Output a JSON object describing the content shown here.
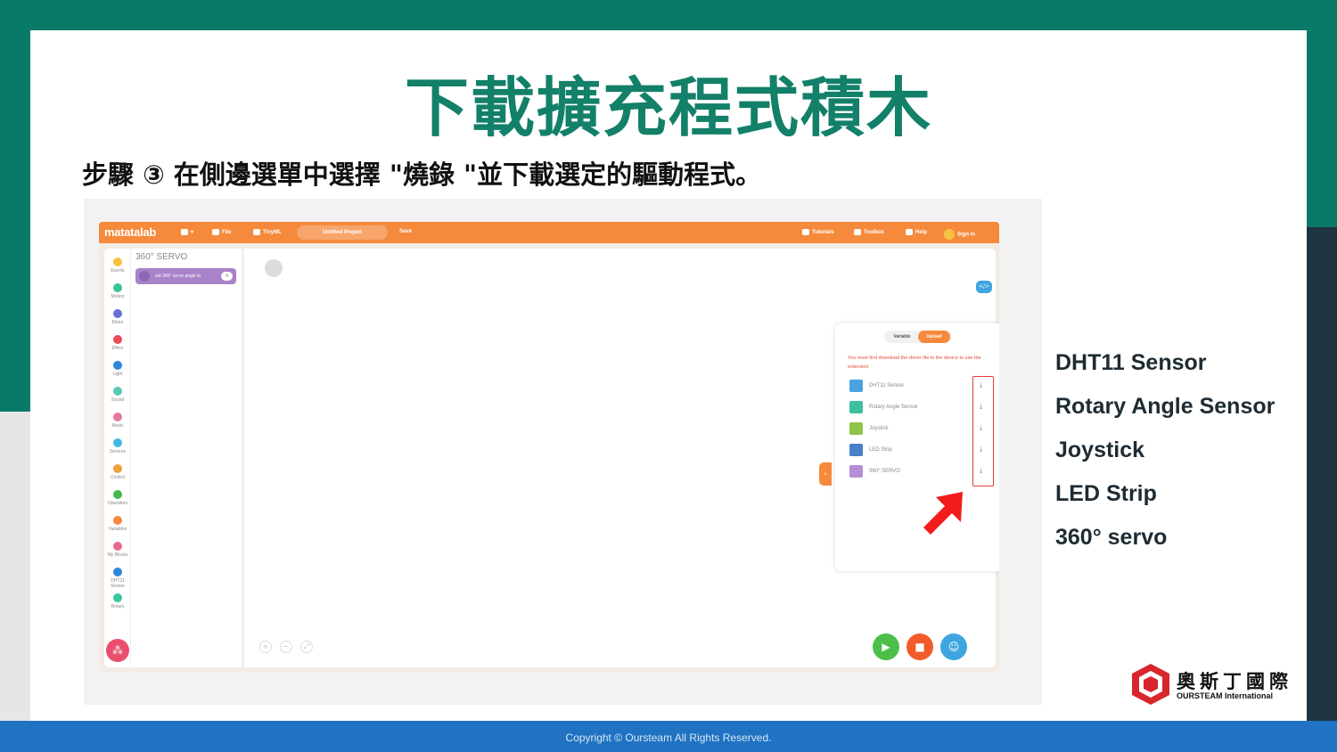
{
  "slide": {
    "title": "下載擴充程式積木",
    "step": "步驟 ③ 在側邊選單中選擇 \"燒錄 \"並下載選定的驅動程式。",
    "footer": "Copyright © Oursteam All Rights Reserved.",
    "frame_colors": {
      "teal": "#0a7a68",
      "navy": "#1e3440",
      "footer_blue": "#1f73c2"
    }
  },
  "app": {
    "logo": "matatalab",
    "menu": {
      "file": "File",
      "tinyml": "TinyML",
      "project": "Untitled Project",
      "save": "Save",
      "tutorials": "Tutorials",
      "toolbox": "Toolbox",
      "help": "Help",
      "signin": "Sign in"
    },
    "categories": [
      {
        "label": "Events",
        "color": "#f6c343"
      },
      {
        "label": "Motion",
        "color": "#3cc48f"
      },
      {
        "label": "Motor",
        "color": "#6a6fd6"
      },
      {
        "label": "Effect",
        "color": "#e84b5a"
      },
      {
        "label": "Light",
        "color": "#2f86d9"
      },
      {
        "label": "Sound",
        "color": "#5cc7b7"
      },
      {
        "label": "Music",
        "color": "#e57ba0"
      },
      {
        "label": "Sensors",
        "color": "#46b7e2"
      },
      {
        "label": "Control",
        "color": "#f0a03c"
      },
      {
        "label": "Operators",
        "color": "#45b84e"
      },
      {
        "label": "Variables",
        "color": "#f58a3c"
      },
      {
        "label": "My Blocks",
        "color": "#ea6b8f"
      },
      {
        "label": "DHT11 Sensor",
        "color": "#2f86d9"
      },
      {
        "label": "Rotary",
        "color": "#3cc4a0"
      }
    ],
    "palette_title": "360° SERVO",
    "block_label": "set 360° servo angle to",
    "block_value": "0",
    "panel": {
      "tab_variable": "Variable",
      "tab_upload": "Upload",
      "note": "You must first download the driver file to the device to use the extension",
      "drivers": [
        {
          "label": "DHT11 Sensor",
          "color": "#4aa3df"
        },
        {
          "label": "Rotary Angle Sensor",
          "color": "#3fbfa0"
        },
        {
          "label": "Joystick",
          "color": "#8fc34a"
        },
        {
          "label": "LED Strip",
          "color": "#4a7fc9"
        },
        {
          "label": "360° SERVO",
          "color": "#b58fd6"
        }
      ]
    }
  },
  "sensors": [
    "DHT11 Sensor",
    "Rotary Angle Sensor",
    "Joystick",
    "LED Strip",
    "360° servo"
  ],
  "brand": {
    "cn": "奧斯丁國際",
    "en": "OURSTEAM International"
  }
}
